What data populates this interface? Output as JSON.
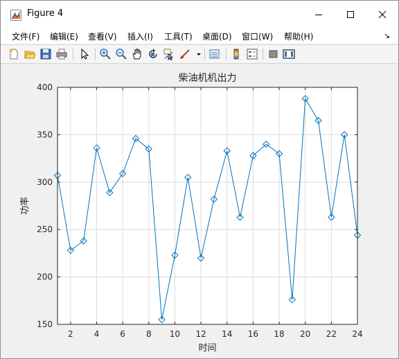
{
  "window": {
    "title": "Figure 4"
  },
  "menu": {
    "items": [
      "文件(F)",
      "编辑(E)",
      "查看(V)",
      "插入(I)",
      "工具(T)",
      "桌面(D)",
      "窗口(W)",
      "帮助(H)"
    ]
  },
  "toolbar": {
    "icons": [
      "new-figure-icon",
      "open-file-icon",
      "save-icon",
      "print-icon",
      "pointer-icon",
      "zoom-in-icon",
      "zoom-out-icon",
      "pan-icon",
      "rotate-3d-icon",
      "data-cursor-icon",
      "brush-icon",
      "link-plot-icon",
      "colorbar-icon",
      "legend-icon",
      "hide-plot-tools-icon",
      "show-plot-tools-icon"
    ]
  },
  "chart_data": {
    "type": "line",
    "title": "柴油机机出力",
    "xlabel": "时间",
    "ylabel": "功率",
    "xlim": [
      1,
      24
    ],
    "ylim": [
      150,
      400
    ],
    "xticks": [
      2,
      4,
      6,
      8,
      10,
      12,
      14,
      16,
      18,
      20,
      22,
      24
    ],
    "yticks": [
      150,
      200,
      250,
      300,
      350,
      400
    ],
    "grid": true,
    "marker": "diamond",
    "color": "#0072bd",
    "series": [
      {
        "x": [
          1,
          2,
          3,
          4,
          5,
          6,
          7,
          8,
          9,
          10,
          11,
          12,
          13,
          14,
          15,
          16,
          17,
          18,
          19,
          20,
          21,
          22,
          23,
          24
        ],
        "values": [
          307,
          228,
          238,
          336,
          289,
          309,
          346,
          335,
          155,
          223,
          305,
          220,
          282,
          333,
          263,
          328,
          340,
          330,
          176,
          388,
          365,
          263,
          350,
          244
        ]
      }
    ]
  }
}
